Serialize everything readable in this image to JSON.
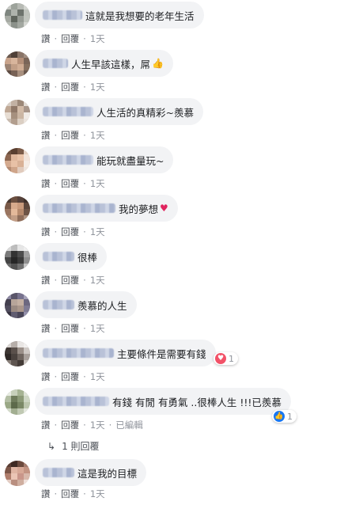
{
  "actions": {
    "like": "讚",
    "reply": "回覆",
    "edited": "已編輯"
  },
  "comments": [
    {
      "text": "這就是我想要的老年生活",
      "time": "1天"
    },
    {
      "text": "人生早該這樣，屌",
      "time": "1天",
      "emoji": "thumbs-up"
    },
    {
      "text": "人生活的真精彩~羨慕",
      "time": "1天"
    },
    {
      "text": "能玩就盡量玩~",
      "time": "1天"
    },
    {
      "text": "我的夢想",
      "time": "1天",
      "emoji": "red-heart"
    },
    {
      "text": "很棒",
      "time": "1天"
    },
    {
      "text": "羨慕的人生",
      "time": "1天"
    },
    {
      "text": "主要條件是需要有錢",
      "time": "1天",
      "reaction": {
        "icon": "love-reaction-icon",
        "count": "1"
      }
    },
    {
      "text": "有錢 有閒 有勇氣 ..很棒人生 !!!已羨慕",
      "time": "1天",
      "edited": true,
      "reaction": {
        "icon": "like-reaction-icon",
        "count": "1"
      }
    },
    {
      "text": "這是我的目標",
      "time": "1天"
    }
  ],
  "replies_link": "1 則回覆",
  "colors": {
    "bubble": "#f2f3f5",
    "love": "#f25268",
    "like": "#1877f2",
    "link": "#4b4f56"
  }
}
